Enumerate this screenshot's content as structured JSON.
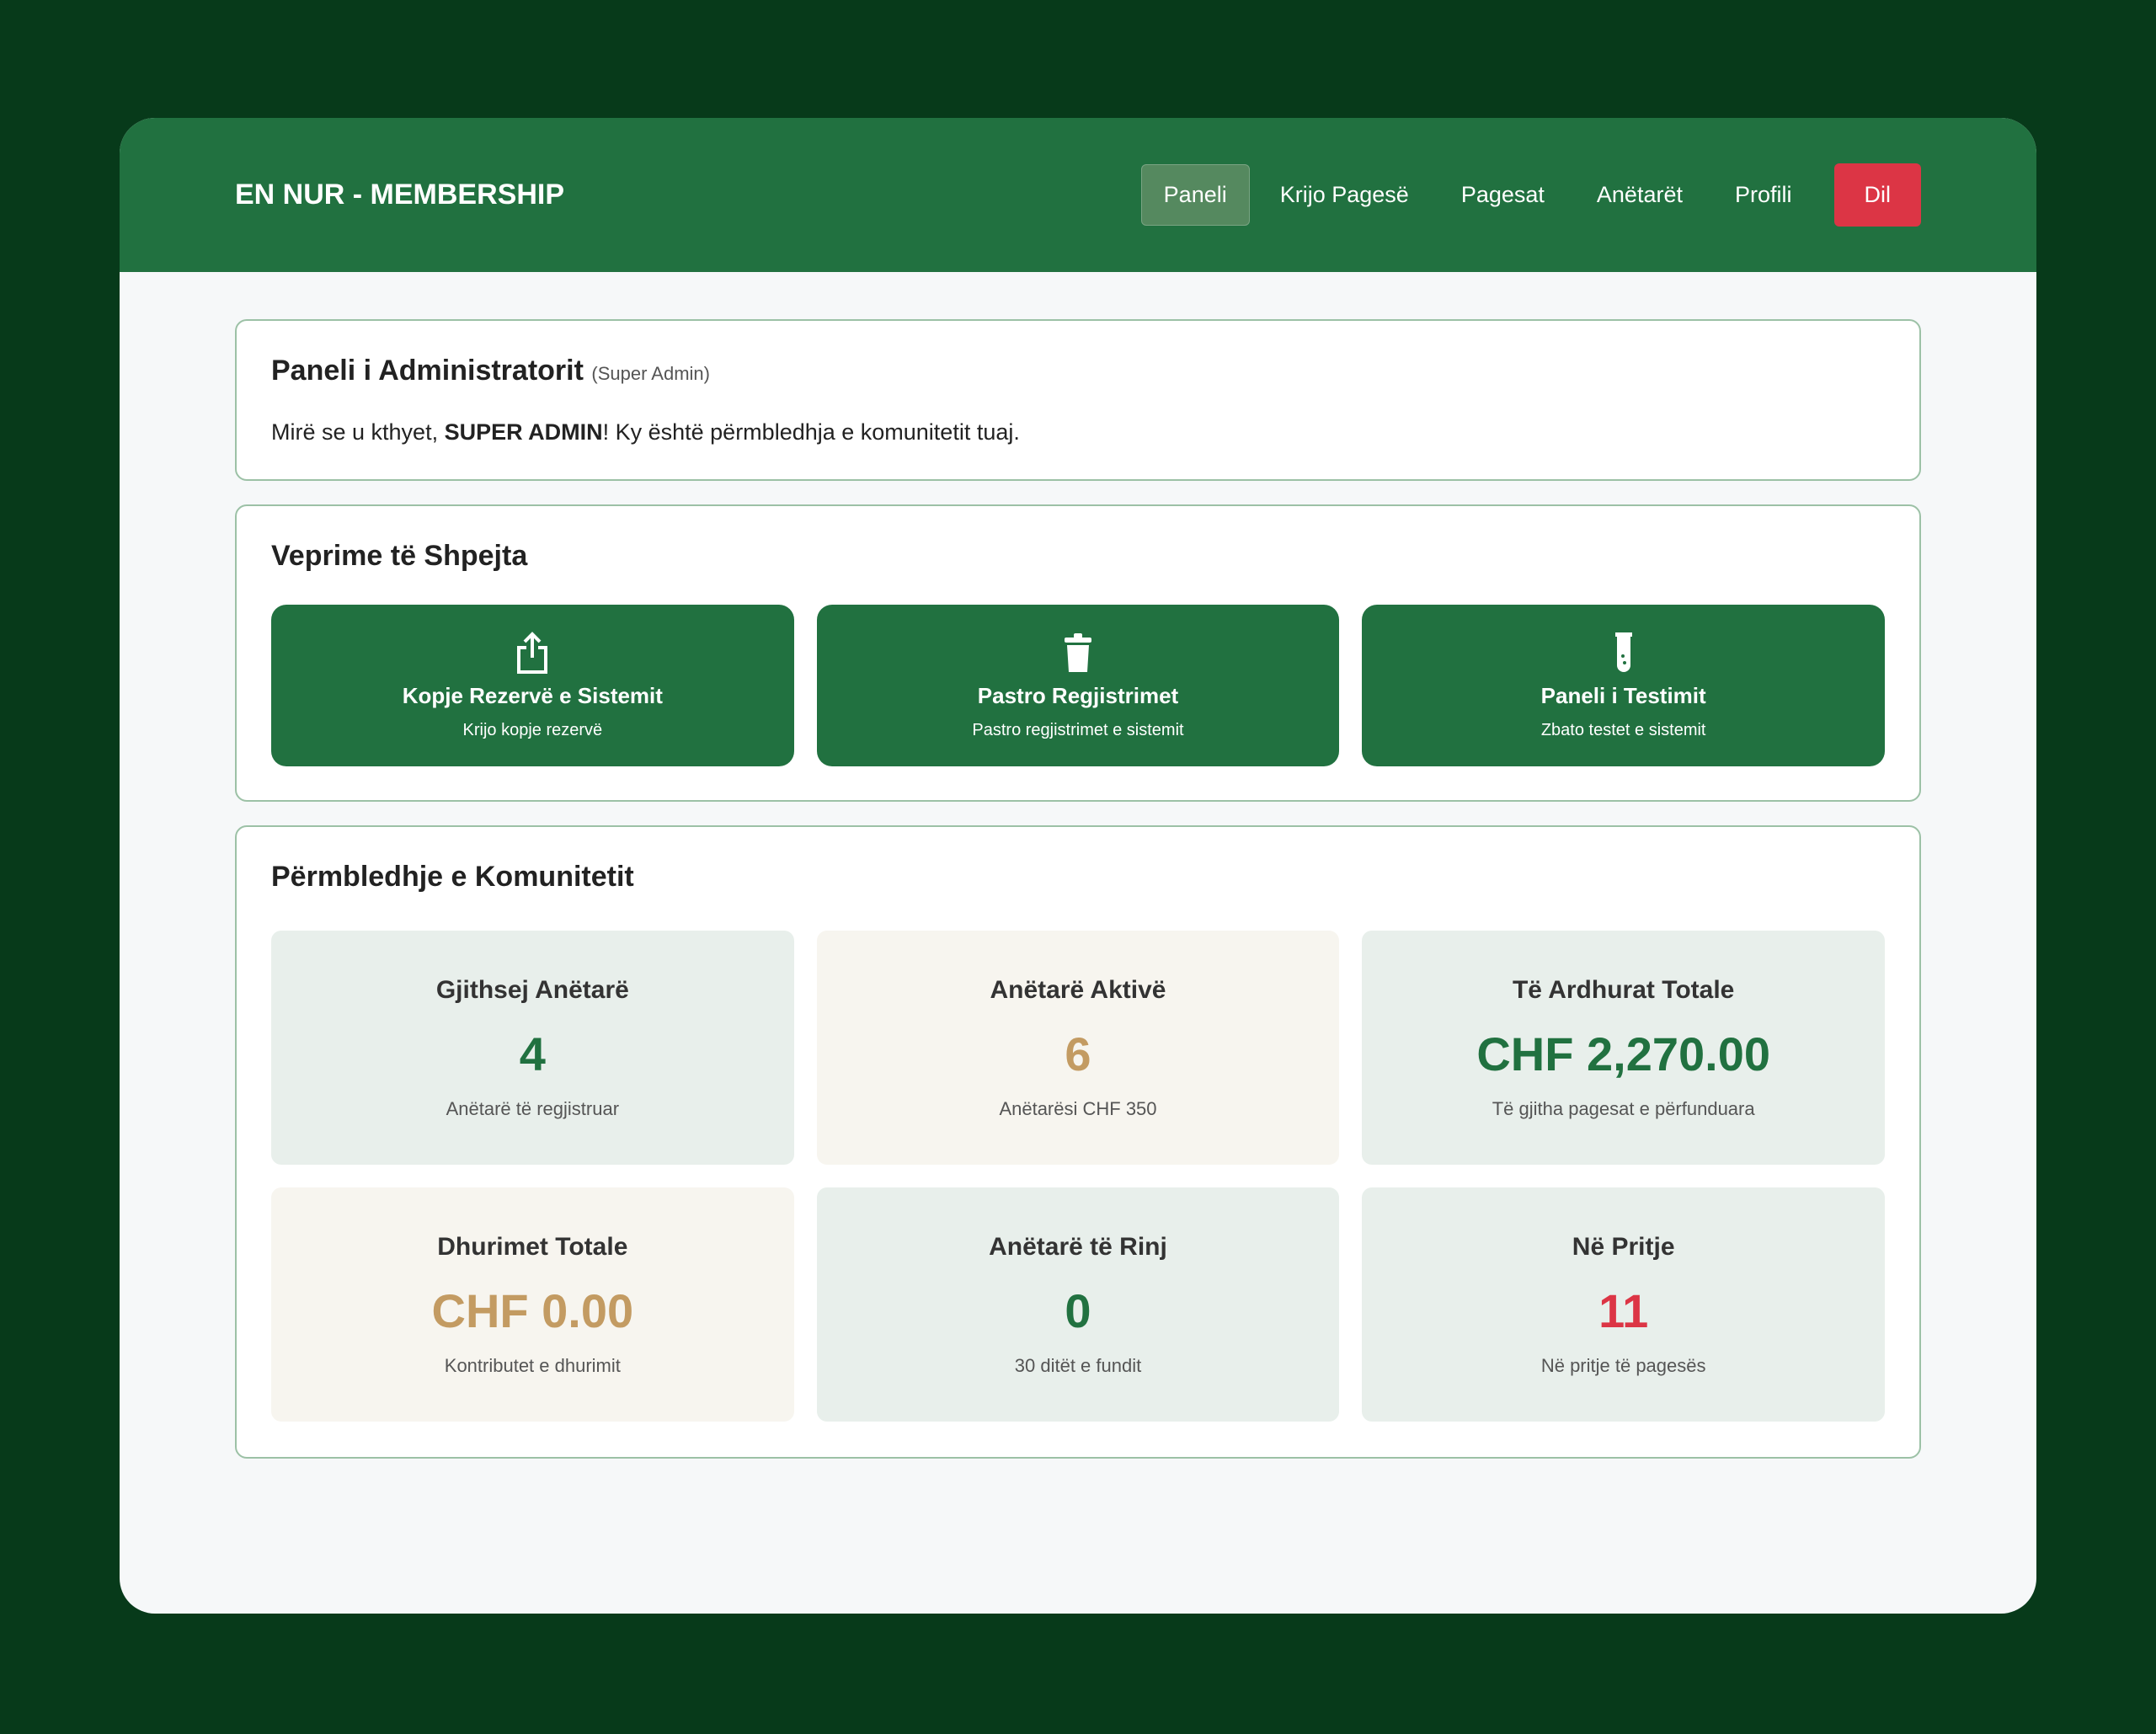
{
  "header": {
    "brand": "EN NUR - MEMBERSHIP",
    "nav": [
      "Paneli",
      "Krijo Pagesë",
      "Pagesat",
      "Anëtarët",
      "Profili"
    ],
    "logout": "Dil"
  },
  "intro": {
    "title": "Paneli i Administratorit",
    "role": "(Super Admin)",
    "welcome_pre": "Mirë se u kthyet, ",
    "welcome_name": "SUPER ADMIN",
    "welcome_post": "! Ky është përmbledhja e komunitetit tuaj."
  },
  "quick": {
    "title": "Veprime të Shpejta",
    "actions": [
      {
        "icon": "share-upload-icon",
        "title": "Kopje Rezervë e Sistemit",
        "sub": "Krijo kopje rezervë"
      },
      {
        "icon": "trash-icon",
        "title": "Pastro Regjistrimet",
        "sub": "Pastro regjistrimet e sistemit"
      },
      {
        "icon": "test-tube-icon",
        "title": "Paneli i Testimit",
        "sub": "Zbato testet e sistemit"
      }
    ]
  },
  "summary": {
    "title": "Përmbledhje e Komunitetit",
    "stats": [
      {
        "label": "Gjithsej Anëtarë",
        "value": "4",
        "desc": "Anëtarë të regjistruar",
        "color": "#217140"
      },
      {
        "label": "Anëtarë Aktivë",
        "value": "6",
        "desc": "Anëtarësi CHF 350",
        "color": "#c39b62"
      },
      {
        "label": "Të Ardhurat Totale",
        "value": "CHF 2,270.00",
        "desc": "Të gjitha pagesat e përfunduara",
        "color": "#217140"
      },
      {
        "label": "Dhurimet Totale",
        "value": "CHF 0.00",
        "desc": "Kontributet e dhurimit",
        "color": "#c39b62"
      },
      {
        "label": "Anëtarë të Rinj",
        "value": "0",
        "desc": "30 ditët e fundit",
        "color": "#217140"
      },
      {
        "label": "Në Pritje",
        "value": "11",
        "desc": "Në pritje të pagesës",
        "color": "#dc3545"
      }
    ]
  }
}
